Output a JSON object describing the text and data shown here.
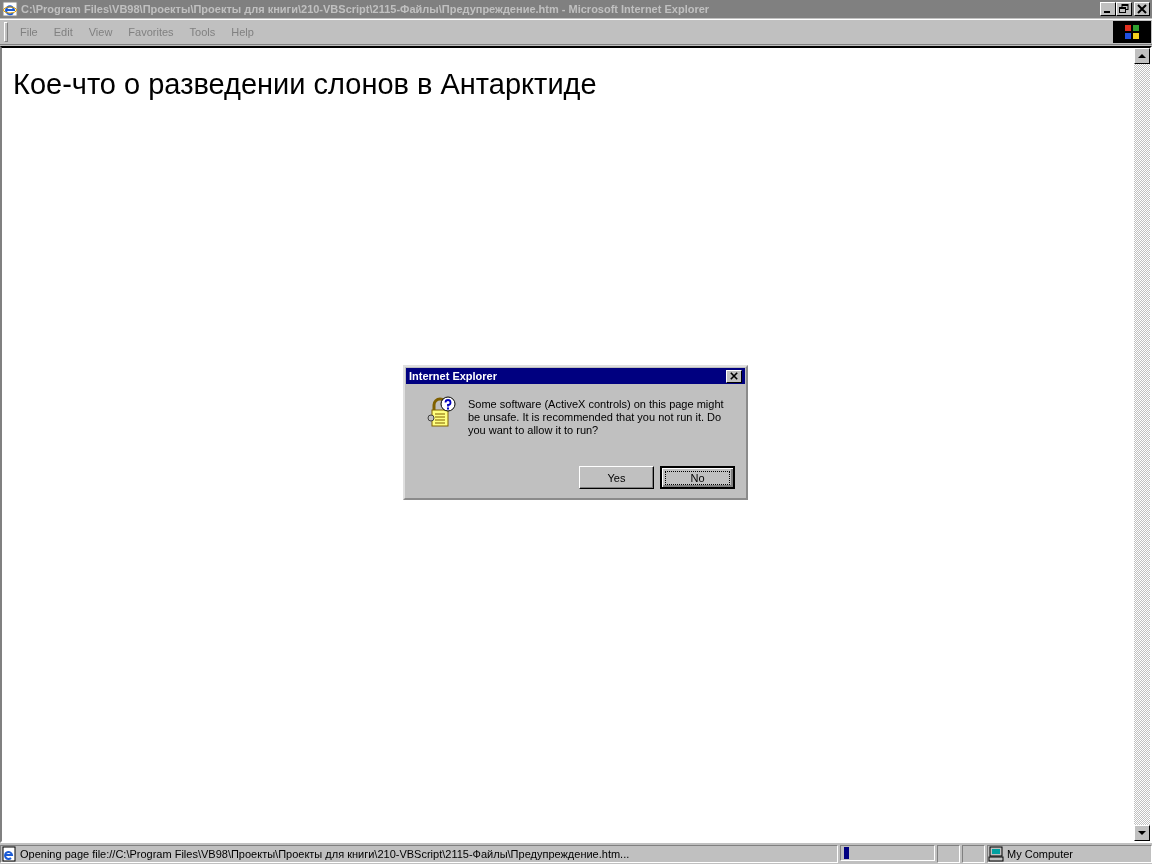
{
  "window": {
    "title": "C:\\Program Files\\VB98\\Проекты\\Проекты для книги\\210-VBScript\\2115-Файлы\\Предупреждение.htm - Microsoft Internet Explorer",
    "active": false
  },
  "menu": [
    "File",
    "Edit",
    "View",
    "Favorites",
    "Tools",
    "Help"
  ],
  "page": {
    "heading": "Кое-что о разведении слонов в Антарктиде"
  },
  "dialog": {
    "title": "Internet Explorer",
    "message": "Some software (ActiveX controls) on this page might be unsafe. It is recommended that you not run it. Do you want to allow it to run?",
    "buttons": [
      {
        "label": "Yes",
        "selected": false
      },
      {
        "label": "No",
        "selected": true
      }
    ]
  },
  "status_bar": {
    "text": "Opening page file://C:\\Program Files\\VB98\\Проекты\\Проекты для книги\\210-VBScript\\2115-Файлы\\Предупреждение.htm...",
    "progress": {
      "level": 0.06
    },
    "zone": "My Computer"
  }
}
